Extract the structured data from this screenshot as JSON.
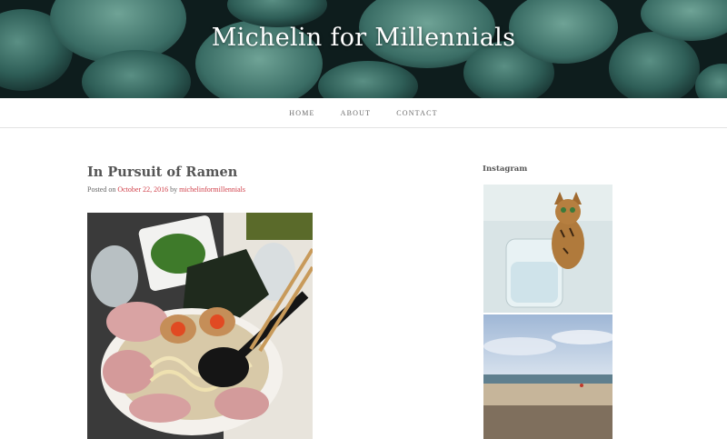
{
  "site": {
    "title": "Michelin for Millennials"
  },
  "nav": {
    "items": [
      "HOME",
      "ABOUT",
      "CONTACT"
    ]
  },
  "post": {
    "title": "In Pursuit of Ramen",
    "posted_on_label": "Posted on",
    "date": "October 22, 2016",
    "by_label": "by",
    "author": "michelinformillennials"
  },
  "sidebar": {
    "widget_title": "Instagram"
  },
  "colors": {
    "accent": "#d0404a",
    "text": "#555555",
    "banner_bg": "#0d1e1e"
  }
}
